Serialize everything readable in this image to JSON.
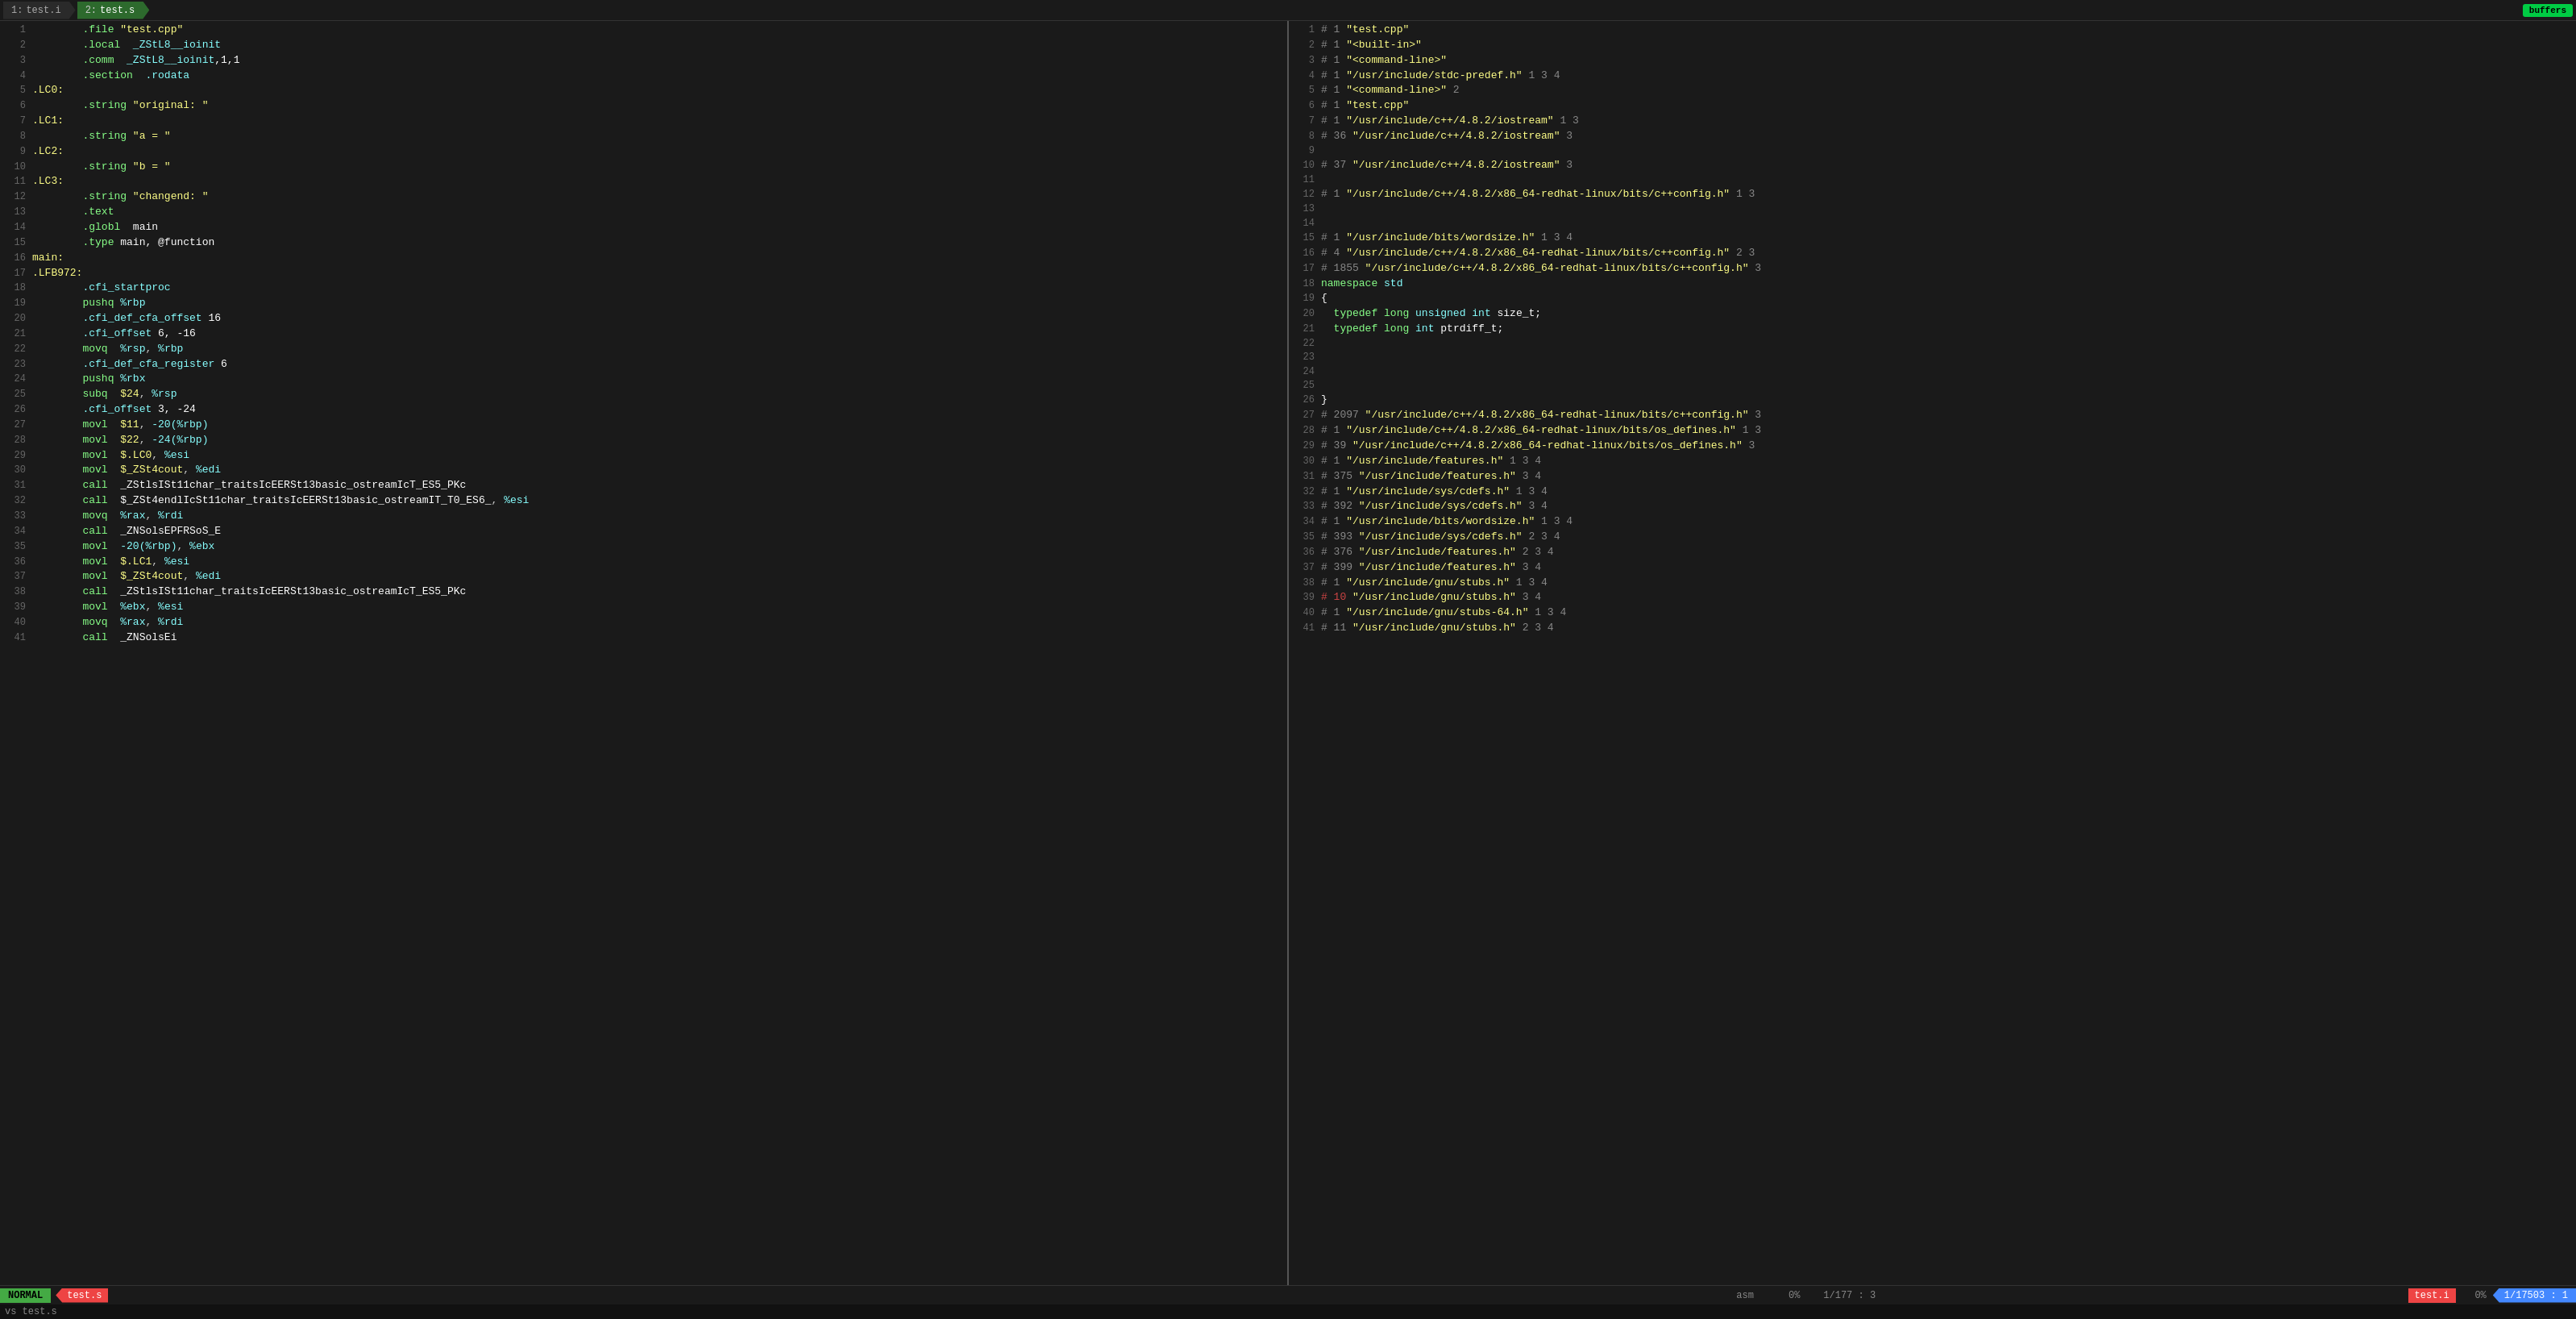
{
  "tabs": [
    {
      "id": 1,
      "label": "test.i",
      "active": false
    },
    {
      "id": 2,
      "label": "test.s",
      "active": true
    }
  ],
  "buffers_label": "buffers",
  "left_pane": {
    "lines": [
      {
        "num": 1,
        "content": "\t<span class='kw-lgreen'>.file</span> <span class='kw-lyellow'>\"test.cpp\"</span>"
      },
      {
        "num": 2,
        "content": "\t<span class='kw-lgreen'>.local</span>  <span class='kw-lcyan'>_ZStL8__ioinit</span>"
      },
      {
        "num": 3,
        "content": "\t<span class='kw-lgreen'>.comm</span>  <span class='kw-lcyan'>_ZStL8__ioinit</span><span class='kw-white'>,1,1</span>"
      },
      {
        "num": 4,
        "content": "\t<span class='kw-lgreen'>.section</span>  <span class='kw-lcyan'>.rodata</span>"
      },
      {
        "num": 5,
        "content": "<span class='kw-lyellow'>.LC0:</span>"
      },
      {
        "num": 6,
        "content": "\t<span class='kw-lgreen'>.string</span> <span class='kw-lyellow'>\"original: \"</span>"
      },
      {
        "num": 7,
        "content": "<span class='kw-lyellow'>.LC1:</span>"
      },
      {
        "num": 8,
        "content": "\t<span class='kw-lgreen'>.string</span> <span class='kw-lyellow'>\"a = \"</span>"
      },
      {
        "num": 9,
        "content": "<span class='kw-lyellow'>.LC2:</span>"
      },
      {
        "num": 10,
        "content": "\t<span class='kw-lgreen'>.string</span> <span class='kw-lyellow'>\"b = \"</span>"
      },
      {
        "num": 11,
        "content": "<span class='kw-lyellow'>.LC3:</span>"
      },
      {
        "num": 12,
        "content": "\t<span class='kw-lgreen'>.string</span> <span class='kw-lyellow'>\"changend: \"</span>"
      },
      {
        "num": 13,
        "content": "\t<span class='kw-lgreen'>.text</span>"
      },
      {
        "num": 14,
        "content": "\t<span class='kw-lgreen'>.globl</span>  <span class='kw-white'>main</span>"
      },
      {
        "num": 15,
        "content": "\t<span class='kw-lgreen'>.type</span> <span class='kw-white'>main, @function</span>"
      },
      {
        "num": 16,
        "content": "<span class='kw-lyellow'>main:</span>"
      },
      {
        "num": 17,
        "content": "<span class='kw-lyellow'>.LFB972:</span>"
      },
      {
        "num": 18,
        "content": "\t<span class='kw-lcyan'>.cfi_startproc</span>"
      },
      {
        "num": 19,
        "content": "\t<span class='kw-lgreen'>pushq</span> <span class='kw-lcyan'>%rbp</span>"
      },
      {
        "num": 20,
        "content": "\t<span class='kw-lcyan'>.cfi_def_cfa_offset</span> <span class='kw-white'>16</span>"
      },
      {
        "num": 21,
        "content": "\t<span class='kw-lcyan'>.cfi_offset</span> <span class='kw-white'>6, -16</span>"
      },
      {
        "num": 22,
        "content": "\t<span class='kw-lgreen'>movq</span>  <span class='kw-lcyan'>%rsp</span>, <span class='kw-lcyan'>%rbp</span>"
      },
      {
        "num": 23,
        "content": "\t<span class='kw-lcyan'>.cfi_def_cfa_register</span> <span class='kw-white'>6</span>"
      },
      {
        "num": 24,
        "content": "\t<span class='kw-lgreen'>pushq</span> <span class='kw-lcyan'>%rbx</span>"
      },
      {
        "num": 25,
        "content": "\t<span class='kw-lgreen'>subq</span>  <span class='kw-lyellow'>$24</span>, <span class='kw-lcyan'>%rsp</span>"
      },
      {
        "num": 26,
        "content": "\t<span class='kw-lcyan'>.cfi_offset</span> <span class='kw-white'>3, -24</span>"
      },
      {
        "num": 27,
        "content": "\t<span class='kw-lgreen'>movl</span>  <span class='kw-lyellow'>$11</span>, <span class='kw-lcyan'>-20(%rbp)</span>"
      },
      {
        "num": 28,
        "content": "\t<span class='kw-lgreen'>movl</span>  <span class='kw-lyellow'>$22</span>, <span class='kw-lcyan'>-24(%rbp)</span>"
      },
      {
        "num": 29,
        "content": "\t<span class='kw-lgreen'>movl</span>  <span class='kw-lyellow'>$.LC0</span>, <span class='kw-lcyan'>%esi</span>"
      },
      {
        "num": 30,
        "content": "\t<span class='kw-lgreen'>movl</span>  <span class='kw-lyellow'>$_ZSt4cout</span>, <span class='kw-lcyan'>%edi</span>"
      },
      {
        "num": 31,
        "content": "\t<span class='kw-lgreen'>call</span>  <span class='kw-white'>_ZStlsISt11char_traitsIcEERSt13basic_ostreamIcT_ES5_PKc</span>"
      },
      {
        "num": 32,
        "content": "\t<span class='kw-lgreen'>call</span>  <span class='kw-white'>$_ZSt4endlIcSt11char_traitsIcEERSt13basic_ostreamIT_T0_ES6_</span>, <span class='kw-lcyan'>%esi</span>"
      },
      {
        "num": 33,
        "content": "\t<span class='kw-lgreen'>movq</span>  <span class='kw-lcyan'>%rax</span>, <span class='kw-lcyan'>%rdi</span>"
      },
      {
        "num": 34,
        "content": "\t<span class='kw-lgreen'>call</span>  <span class='kw-white'>_ZNSolsEPFRSoS_E</span>"
      },
      {
        "num": 35,
        "content": "\t<span class='kw-lgreen'>movl</span>  <span class='kw-lcyan'>-20(%rbp)</span>, <span class='kw-lcyan'>%ebx</span>"
      },
      {
        "num": 36,
        "content": "\t<span class='kw-lgreen'>movl</span>  <span class='kw-lyellow'>$.LC1</span>, <span class='kw-lcyan'>%esi</span>"
      },
      {
        "num": 37,
        "content": "\t<span class='kw-lgreen'>movl</span>  <span class='kw-lyellow'>$_ZSt4cout</span>, <span class='kw-lcyan'>%edi</span>"
      },
      {
        "num": 38,
        "content": "\t<span class='kw-lgreen'>call</span>  <span class='kw-white'>_ZStlsISt11char_traitsIcEERSt13basic_ostreamIcT_ES5_PKc</span>"
      },
      {
        "num": 39,
        "content": "\t<span class='kw-lgreen'>movl</span>  <span class='kw-lcyan'>%ebx</span>, <span class='kw-lcyan'>%esi</span>"
      },
      {
        "num": 40,
        "content": "\t<span class='kw-lgreen'>movq</span>  <span class='kw-lcyan'>%rax</span>, <span class='kw-lcyan'>%rdi</span>"
      },
      {
        "num": 41,
        "content": "\t<span class='kw-lgreen'>call</span>  <span class='kw-white'>_ZNSolsEi</span>"
      }
    ]
  },
  "right_pane": {
    "lines": [
      {
        "num": 1,
        "content": "<span class='kw-gray'># 1 </span><span class='kw-lyellow'>\"test.cpp\"</span>"
      },
      {
        "num": 2,
        "content": "<span class='kw-gray'># 1 </span><span class='kw-lyellow'>\"&lt;built-in&gt;\"</span>"
      },
      {
        "num": 3,
        "content": "<span class='kw-gray'># 1 </span><span class='kw-lyellow'>\"&lt;command-line&gt;\"</span>"
      },
      {
        "num": 4,
        "content": "<span class='kw-gray'># 1 </span><span class='kw-lyellow'>\"/usr/include/stdc-predef.h\"</span><span class='kw-gray'> 1 3 4</span>"
      },
      {
        "num": 5,
        "content": "<span class='kw-gray'># 1 </span><span class='kw-lyellow'>\"&lt;command-line&gt;\"</span><span class='kw-gray'> 2</span>"
      },
      {
        "num": 6,
        "content": "<span class='kw-gray'># 1 </span><span class='kw-lyellow'>\"test.cpp\"</span>"
      },
      {
        "num": 7,
        "content": "<span class='kw-gray'># 1 </span><span class='kw-lyellow'>\"/usr/include/c++/4.8.2/iostream\"</span><span class='kw-gray'> 1 3</span>"
      },
      {
        "num": 8,
        "content": "<span class='kw-gray'># 36 </span><span class='kw-lyellow'>\"/usr/include/c++/4.8.2/iostream\"</span><span class='kw-gray'> 3</span>"
      },
      {
        "num": 9,
        "content": ""
      },
      {
        "num": 10,
        "content": "<span class='kw-gray'># 37 </span><span class='kw-lyellow'>\"/usr/include/c++/4.8.2/iostream\"</span><span class='kw-gray'> 3</span>"
      },
      {
        "num": 11,
        "content": ""
      },
      {
        "num": 12,
        "content": "<span class='kw-gray'># 1 </span><span class='kw-lyellow'>\"/usr/include/c++/4.8.2/x86_64-redhat-linux/bits/c++config.h\"</span><span class='kw-gray'> 1 3</span>"
      },
      {
        "num": 13,
        "content": ""
      },
      {
        "num": 14,
        "content": ""
      },
      {
        "num": 15,
        "content": "<span class='kw-gray'># 1 </span><span class='kw-lyellow'>\"/usr/include/bits/wordsize.h\"</span><span class='kw-gray'> 1 3 4</span>"
      },
      {
        "num": 16,
        "content": "<span class='kw-gray'># 4 </span><span class='kw-lyellow'>\"/usr/include/c++/4.8.2/x86_64-redhat-linux/bits/c++config.h\"</span><span class='kw-gray'> 2 3</span>"
      },
      {
        "num": 17,
        "content": "<span class='kw-gray'># 1855 </span><span class='kw-lyellow'>\"/usr/include/c++/4.8.2/x86_64-redhat-linux/bits/c++config.h\"</span><span class='kw-gray'> 3</span>"
      },
      {
        "num": 18,
        "content": "<span class='kw-lgreen'>namespace</span> <span class='kw-lcyan'>std</span>"
      },
      {
        "num": 19,
        "content": "<span class='kw-white'>{</span>"
      },
      {
        "num": 20,
        "content": "  <span class='kw-lgreen'>typedef</span> <span class='kw-lgreen'>long</span> <span class='kw-lcyan'>unsigned</span> <span class='kw-lcyan'>int</span> <span class='kw-white'>size_t;</span>"
      },
      {
        "num": 21,
        "content": "  <span class='kw-lgreen'>typedef</span> <span class='kw-lgreen'>long</span> <span class='kw-lcyan'>int</span> <span class='kw-white'>ptrdiff_t;</span>"
      },
      {
        "num": 22,
        "content": ""
      },
      {
        "num": 23,
        "content": ""
      },
      {
        "num": 24,
        "content": ""
      },
      {
        "num": 25,
        "content": ""
      },
      {
        "num": 26,
        "content": "<span class='kw-white'>}</span>"
      },
      {
        "num": 27,
        "content": "<span class='kw-gray'># 2097 </span><span class='kw-lyellow'>\"/usr/include/c++/4.8.2/x86_64-redhat-linux/bits/c++config.h\"</span><span class='kw-gray'> 3</span>"
      },
      {
        "num": 28,
        "content": "<span class='kw-gray'># 1 </span><span class='kw-lyellow'>\"/usr/include/c++/4.8.2/x86_64-redhat-linux/bits/os_defines.h\"</span><span class='kw-gray'> 1 3</span>"
      },
      {
        "num": 29,
        "content": "<span class='kw-gray'># 39 </span><span class='kw-lyellow'>\"/usr/include/c++/4.8.2/x86_64-redhat-linux/bits/os_defines.h\"</span><span class='kw-gray'> 3</span>"
      },
      {
        "num": 30,
        "content": "<span class='kw-gray'># 1 </span><span class='kw-lyellow'>\"/usr/include/features.h\"</span><span class='kw-gray'> 1 3 4</span>"
      },
      {
        "num": 31,
        "content": "<span class='kw-gray'># 375 </span><span class='kw-lyellow'>\"/usr/include/features.h\"</span><span class='kw-gray'> 3 4</span>"
      },
      {
        "num": 32,
        "content": "<span class='kw-gray'># 1 </span><span class='kw-lyellow'>\"/usr/include/sys/cdefs.h\"</span><span class='kw-gray'> 1 3 4</span>"
      },
      {
        "num": 33,
        "content": "<span class='kw-gray'># 392 </span><span class='kw-lyellow'>\"/usr/include/sys/cdefs.h\"</span><span class='kw-gray'> 3 4</span>"
      },
      {
        "num": 34,
        "content": "<span class='kw-gray'># 1 </span><span class='kw-lyellow'>\"/usr/include/bits/wordsize.h\"</span><span class='kw-gray'> 1 3 4</span>"
      },
      {
        "num": 35,
        "content": "<span class='kw-gray'># 393 </span><span class='kw-lyellow'>\"/usr/include/sys/cdefs.h\"</span><span class='kw-gray'> 2 3 4</span>"
      },
      {
        "num": 36,
        "content": "<span class='kw-gray'># 376 </span><span class='kw-lyellow'>\"/usr/include/features.h\"</span><span class='kw-gray'> 2 3 4</span>"
      },
      {
        "num": 37,
        "content": "<span class='kw-gray'># 399 </span><span class='kw-lyellow'>\"/usr/include/features.h\"</span><span class='kw-gray'> 3 4</span>"
      },
      {
        "num": 38,
        "content": "<span class='kw-gray'># 1 </span><span class='kw-lyellow'>\"/usr/include/gnu/stubs.h\"</span><span class='kw-gray'> 1 3 4</span>"
      },
      {
        "num": 39,
        "content": "<span class='kw-red'># 10 </span><span class='kw-lyellow'>\"/usr/include/gnu/stubs.h\"</span><span class='kw-gray'> 3 4</span>"
      },
      {
        "num": 40,
        "content": "<span class='kw-gray'># 1 </span><span class='kw-lyellow'>\"/usr/include/gnu/stubs-64.h\"</span><span class='kw-gray'> 1 3 4</span>"
      },
      {
        "num": 41,
        "content": "<span class='kw-gray'># 11 </span><span class='kw-lyellow'>\"/usr/include/gnu/stubs.h\"</span><span class='kw-gray'> 2 3 4</span>"
      }
    ]
  },
  "status_bar": {
    "mode": "NORMAL",
    "left_file": "test.s",
    "center": "asm",
    "progress": "0%",
    "position": "1/177 : 3",
    "right_file": "test.i",
    "right_progress": "0%",
    "right_position": "1/17503 : 1"
  },
  "command_line": {
    "text": "vs test.s"
  }
}
